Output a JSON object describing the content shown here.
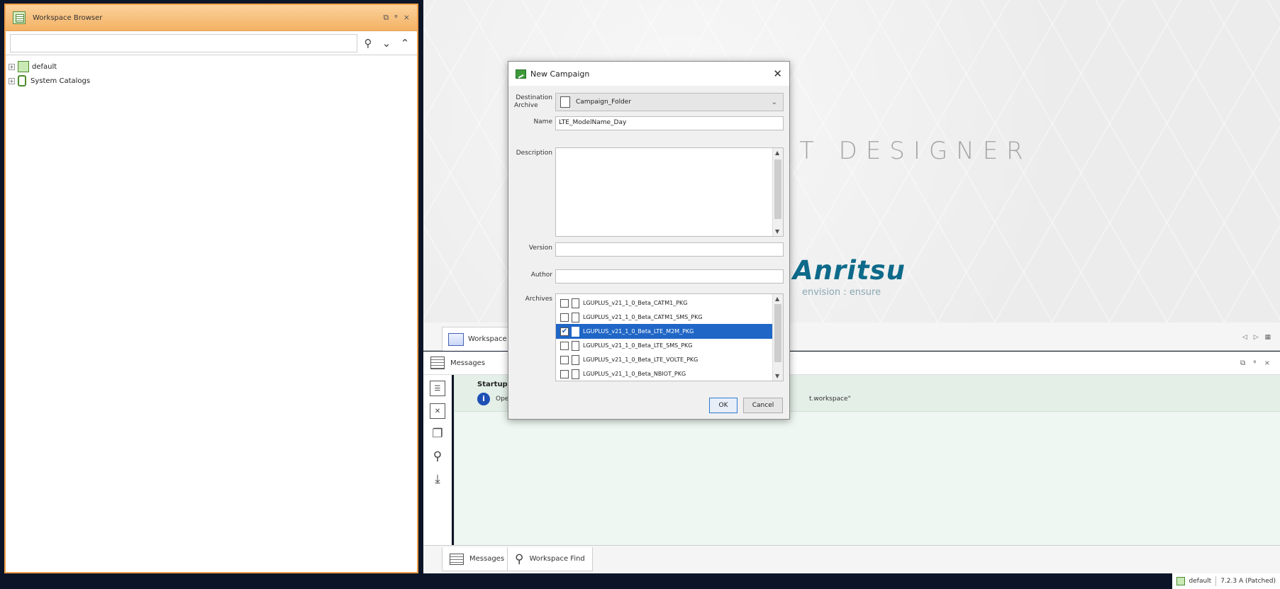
{
  "workspace_browser": {
    "title": "Workspace Browser",
    "controls": [
      "⧉",
      "ᵠ",
      "×"
    ],
    "search_placeholder": "",
    "tree": [
      {
        "label": "default"
      },
      {
        "label": "System Catalogs"
      }
    ]
  },
  "background": {
    "product_title": "EST DESIGNER",
    "brand": "Anritsu",
    "tagline": "envision : ensure"
  },
  "workspace_tab": {
    "label": "Workspace D",
    "controls": "◁ ▷ ▦"
  },
  "messages_panel": {
    "title": "Messages",
    "controls": "⧉ ᵠ ×",
    "startup_title": "Startup Repo",
    "startup_text": "Ope",
    "startup_text_right": "t.workspace\""
  },
  "bottom_tabs": {
    "messages": "Messages",
    "workspace_find": "Workspace Find"
  },
  "status_bar": {
    "workspace": "default",
    "version": "7.2.3 A (Patched)"
  },
  "dialog": {
    "title": "New Campaign",
    "destination_label_1": "Destination",
    "destination_label_2": "Archive",
    "destination_value": "Campaign_Folder",
    "name_label": "Name",
    "name_value": "LTE_ModelName_Day",
    "description_label": "Description",
    "version_label": "Version",
    "version_value": "",
    "author_label": "Author",
    "author_value": "",
    "archives_label": "Archives",
    "archives": [
      {
        "label": "LGUPLUS_v21_1_0_Beta_CATM1_PKG",
        "checked": false,
        "selected": false
      },
      {
        "label": "LGUPLUS_v21_1_0_Beta_CATM1_SMS_PKG",
        "checked": false,
        "selected": false
      },
      {
        "label": "LGUPLUS_v21_1_0_Beta_LTE_M2M_PKG",
        "checked": true,
        "selected": true
      },
      {
        "label": "LGUPLUS_v21_1_0_Beta_LTE_SMS_PKG",
        "checked": false,
        "selected": false
      },
      {
        "label": "LGUPLUS_v21_1_0_Beta_LTE_VOLTE_PKG",
        "checked": false,
        "selected": false
      },
      {
        "label": "LGUPLUS_v21_1_0_Beta_NBIOT_PKG",
        "checked": false,
        "selected": false
      }
    ],
    "ok_label": "OK",
    "cancel_label": "Cancel"
  },
  "colors": {
    "panel_accent": "#f0a14a",
    "selection": "#1f66c6",
    "brand": "#0d6a8a"
  }
}
